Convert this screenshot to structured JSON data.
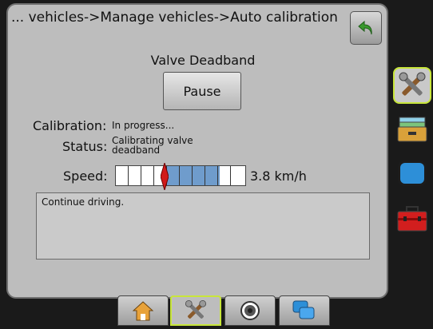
{
  "header": {
    "breadcrumb": "... vehicles->Manage vehicles->Auto calibration"
  },
  "calibration": {
    "heading": "Valve Deadband",
    "pause_label": "Pause",
    "calibration_label": "Calibration:",
    "calibration_value": "In progress...",
    "status_label": "Status:",
    "status_value_line1": "Calibrating valve",
    "status_value_line2": "deadband",
    "speed_label": "Speed:",
    "speed_value": "3.8 km/h",
    "speed_fill_fraction": 0.42
  },
  "message": {
    "text": "Continue driving."
  },
  "side_tabs": [
    "tools-icon",
    "storage-icon",
    "console-icon",
    "toolbox-icon"
  ],
  "bottom_tabs": [
    "home-icon",
    "tools-icon",
    "gauge-icon",
    "windows-icon"
  ],
  "colors": {
    "selected_outline": "#c8e63a",
    "back_arrow": "#3a9a2e",
    "speed_fill": "#6f9ccc",
    "needle": "#d11a1a"
  }
}
